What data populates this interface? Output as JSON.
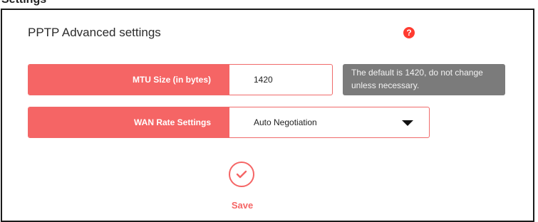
{
  "header": {
    "cut_title": "Settings"
  },
  "section": {
    "title": "PPTP Advanced settings",
    "help_icon": "question-mark-icon"
  },
  "mtu": {
    "label": "MTU Size (in bytes)",
    "value": "1420",
    "hint": "The default is 1420, do not change unless necessary."
  },
  "wan_rate": {
    "label": "WAN Rate Settings",
    "selected": "Auto Negotiation"
  },
  "actions": {
    "save_label": "Save",
    "save_icon": "check-icon"
  },
  "colors": {
    "accent": "#f56565",
    "tooltip_bg": "#7b7b7b",
    "help": "#ff3b30"
  }
}
